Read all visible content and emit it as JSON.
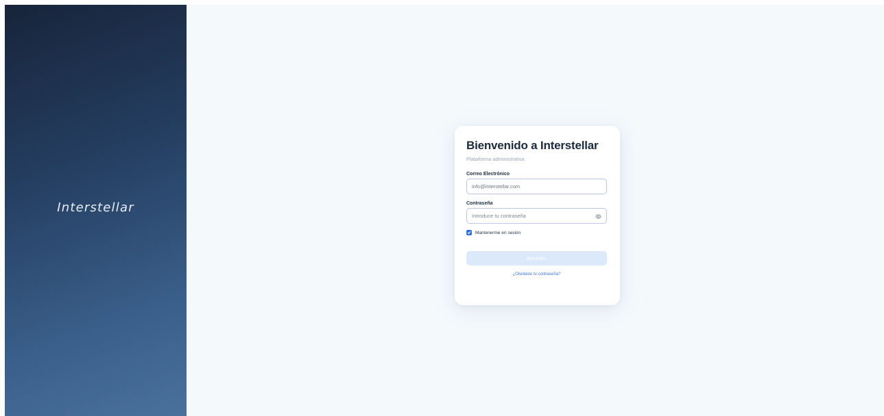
{
  "brand": {
    "logo_text": "Interstellar"
  },
  "login": {
    "title": "Bienvenido a Interstellar",
    "subtitle": "Plataforma administrativa",
    "email_label": "Correo Electrónico",
    "email_value": "info@interstellar.com",
    "password_label": "Contraseña",
    "password_placeholder": "Introduce tu contraseña",
    "remember_label": "Mantenerme en sesión",
    "remember_checked": true,
    "submit_label": "Acceder",
    "forgot_label": "¿Olvidaste tu contraseña?"
  },
  "icons": {
    "password_toggle": "eye-icon",
    "checkbox_mark": "check-icon"
  },
  "colors": {
    "brand_gradient_start": "#17243a",
    "brand_gradient_end": "#4a709c",
    "accent": "#2f6fd6",
    "button_disabled": "#dce9fb",
    "background": "#f4f9fc"
  }
}
